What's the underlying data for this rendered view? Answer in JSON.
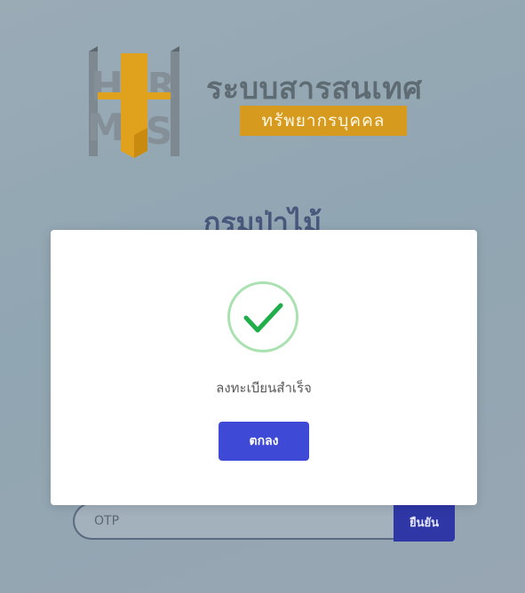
{
  "logo": {
    "mark_letters": [
      "H",
      "R",
      "M",
      "S"
    ],
    "title": "ระบบสารสนเทศ",
    "subtitle": "ทรัพยากรบุคคล",
    "colors": {
      "grey": "#5f6b73",
      "gold": "#d69a1e"
    }
  },
  "org_title": "กรมป่าไม้",
  "otp": {
    "placeholder": "OTP",
    "confirm_label": "ยืนยัน"
  },
  "modal": {
    "icon": "success-check-icon",
    "message": "ลงทะเบียนสำเร็จ",
    "ok_label": "ตกลง",
    "colors": {
      "check": "#1fae4a",
      "ring": "#a9e1b0",
      "button": "#3e4ad6"
    }
  }
}
